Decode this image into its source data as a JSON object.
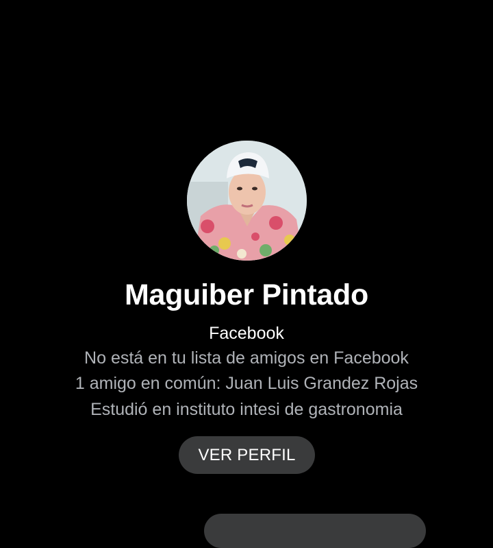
{
  "profile": {
    "name": "Maguiber Pintado",
    "source": "Facebook",
    "details": [
      "No está en tu lista de amigos en Facebook",
      "1 amigo en común: Juan Luis Grandez Rojas",
      "Estudió en instituto intesi de gastronomia"
    ],
    "avatar_icon": "profile-photo",
    "view_profile_label": "VER PERFIL"
  },
  "colors": {
    "background": "#000000",
    "text_primary": "#ffffff",
    "text_secondary": "#b0b3b8",
    "button_background": "#3a3b3c"
  }
}
